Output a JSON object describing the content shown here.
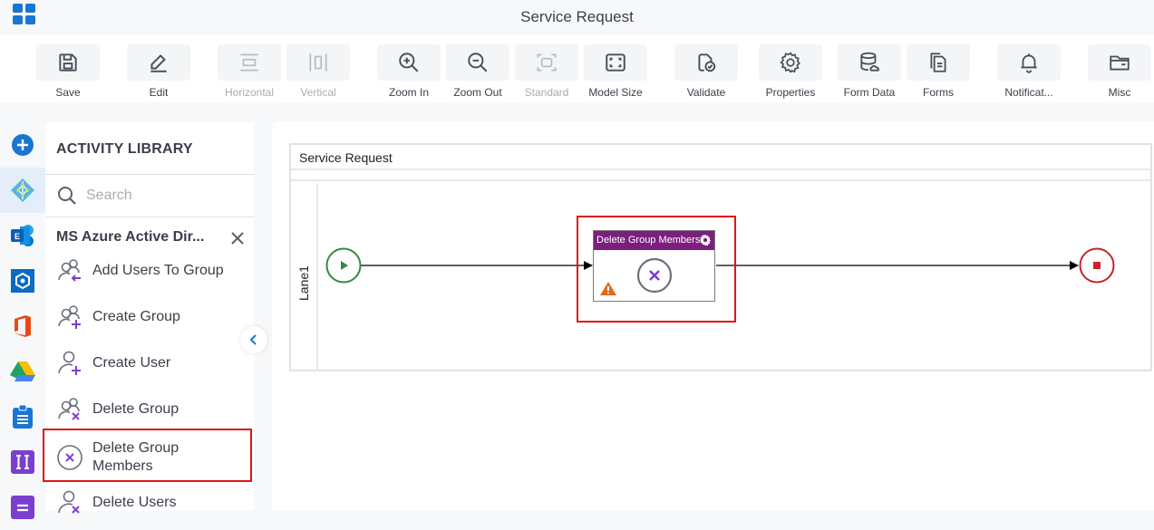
{
  "window": {
    "title": "Service Request"
  },
  "toolbar": {
    "buttons": [
      {
        "id": "save",
        "label": "Save",
        "icon": "save-icon",
        "enabled": true
      },
      {
        "id": "edit",
        "label": "Edit",
        "icon": "pencil-icon",
        "enabled": true
      },
      {
        "id": "horizontal",
        "label": "Horizontal",
        "icon": "horizontal-layout-icon",
        "enabled": false
      },
      {
        "id": "vertical",
        "label": "Vertical",
        "icon": "vertical-layout-icon",
        "enabled": false
      },
      {
        "id": "zoom-in",
        "label": "Zoom In",
        "icon": "zoom-in-icon",
        "enabled": true
      },
      {
        "id": "zoom-out",
        "label": "Zoom Out",
        "icon": "zoom-out-icon",
        "enabled": true
      },
      {
        "id": "standard",
        "label": "Standard",
        "icon": "standard-size-icon",
        "enabled": false
      },
      {
        "id": "model-size",
        "label": "Model Size",
        "icon": "model-size-icon",
        "enabled": true
      },
      {
        "id": "validate",
        "label": "Validate",
        "icon": "validate-icon",
        "enabled": true
      },
      {
        "id": "properties",
        "label": "Properties",
        "icon": "gear-icon",
        "enabled": true
      },
      {
        "id": "form-data",
        "label": "Form Data",
        "icon": "database-icon",
        "enabled": true
      },
      {
        "id": "forms",
        "label": "Forms",
        "icon": "forms-icon",
        "enabled": true
      },
      {
        "id": "notifications",
        "label": "Notificat...",
        "icon": "bell-icon",
        "enabled": true
      },
      {
        "id": "misc",
        "label": "Misc",
        "icon": "folder-icon",
        "enabled": true
      }
    ]
  },
  "rail": {
    "items": [
      {
        "name": "add",
        "icon": "plus-circle-icon"
      },
      {
        "name": "ms-azure-active-directory",
        "icon": "azure-ad-icon",
        "active": true
      },
      {
        "name": "exchange",
        "icon": "exchange-icon"
      },
      {
        "name": "service",
        "icon": "hexagon-icon"
      },
      {
        "name": "office-365",
        "icon": "office-icon"
      },
      {
        "name": "google-drive",
        "icon": "google-drive-icon"
      },
      {
        "name": "clipboard",
        "icon": "clipboard-icon"
      },
      {
        "name": "text-field",
        "icon": "text-cursor-icon"
      },
      {
        "name": "menu",
        "icon": "menu-icon"
      }
    ]
  },
  "library": {
    "title": "ACTIVITY LIBRARY",
    "search_placeholder": "Search",
    "search_value": "",
    "group_title": "MS Azure Active Dir...",
    "items": [
      {
        "label": "Add Users To Group",
        "icon": "users-arrow-icon"
      },
      {
        "label": "Create Group",
        "icon": "users-plus-icon"
      },
      {
        "label": "Create User",
        "icon": "user-plus-icon"
      },
      {
        "label": "Delete Group",
        "icon": "users-x-icon"
      },
      {
        "label": "Delete Group Members",
        "icon": "circle-x-icon",
        "highlighted": true
      },
      {
        "label": "Delete Users",
        "icon": "user-x-icon"
      }
    ]
  },
  "canvas": {
    "pool_title": "Service Request",
    "lane_label": "Lane1",
    "start_event": {
      "type": "start",
      "color": "#2e8b45"
    },
    "task": {
      "title": "Delete Group Members...",
      "warning": true,
      "header_color": "#7b1f7e",
      "highlighted": true
    },
    "end_event": {
      "type": "end",
      "color": "#c0262b"
    }
  },
  "colors": {
    "accent": "#1976d2",
    "highlight": "#e01515",
    "icon_purple": "#7b3fd6",
    "warning": "#e06a1b"
  }
}
